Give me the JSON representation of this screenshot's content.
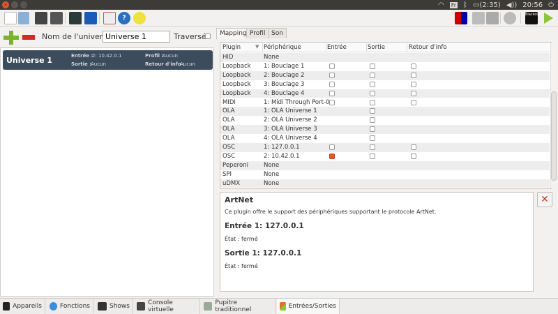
{
  "titlebar": {
    "tray": {
      "lang": "Fr",
      "battery": "(2:35)",
      "time": "20:56"
    }
  },
  "universe_editor": {
    "name_label": "Nom de l'univers :",
    "name_value": "Universe 1",
    "passthrough_label": "Traversé"
  },
  "universe_list": [
    {
      "name": "Universe 1",
      "input_label": "Entrée :",
      "input": "2: 10.42.0.1",
      "output_label": "Sortie :",
      "output": "Aucun",
      "profile_label": "Profil :",
      "profile": "Aucun",
      "feedback_label": "Retour d'info :",
      "feedback": "Aucun"
    }
  ],
  "tabs": [
    "Mapping",
    "Profil",
    "Son"
  ],
  "table": {
    "headers": [
      "Plugin",
      "Périphérique",
      "Entrée",
      "Sortie",
      "Retour d'info"
    ],
    "rows": [
      {
        "plugin": "HID",
        "device": "None",
        "in": null,
        "out": null,
        "fb": null
      },
      {
        "plugin": "Loopback",
        "device": "1: Bouclage 1",
        "in": false,
        "out": false,
        "fb": false
      },
      {
        "plugin": "Loopback",
        "device": "2: Bouclage 2",
        "in": false,
        "out": false,
        "fb": false
      },
      {
        "plugin": "Loopback",
        "device": "3: Bouclage 3",
        "in": false,
        "out": false,
        "fb": false
      },
      {
        "plugin": "Loopback",
        "device": "4: Bouclage 4",
        "in": false,
        "out": false,
        "fb": false
      },
      {
        "plugin": "MIDI",
        "device": "1: Midi Through Port-0",
        "in": false,
        "out": false,
        "fb": false
      },
      {
        "plugin": "OLA",
        "device": "1: OLA Universe 1",
        "in": null,
        "out": false,
        "fb": null
      },
      {
        "plugin": "OLA",
        "device": "2: OLA Universe 2",
        "in": null,
        "out": false,
        "fb": null
      },
      {
        "plugin": "OLA",
        "device": "3: OLA Universe 3",
        "in": null,
        "out": false,
        "fb": null
      },
      {
        "plugin": "OLA",
        "device": "4: OLA Universe 4",
        "in": null,
        "out": false,
        "fb": null
      },
      {
        "plugin": "OSC",
        "device": "1: 127.0.0.1",
        "in": false,
        "out": false,
        "fb": false
      },
      {
        "plugin": "OSC",
        "device": "2: 10.42.0.1",
        "in": true,
        "out": false,
        "fb": false
      },
      {
        "plugin": "Peperoni",
        "device": "None",
        "in": null,
        "out": null,
        "fb": null
      },
      {
        "plugin": "SPI",
        "device": "None",
        "in": null,
        "out": null,
        "fb": null
      },
      {
        "plugin": "uDMX",
        "device": "None",
        "in": null,
        "out": null,
        "fb": null
      }
    ]
  },
  "info": {
    "title": "ArtNet",
    "description": "Ce plugin offre le support des périphériques supportant le protocole ArtNet.",
    "input_title": "Entrée 1: 127.0.0.1",
    "input_state": "État : fermé",
    "output_title": "Sortie 1: 127.0.0.1",
    "output_state": "État : fermé"
  },
  "toolbar_right": {
    "blackout": "Blackout"
  },
  "bottom_tabs": [
    "Appareils",
    "Fonctions",
    "Shows",
    "Console virtuelle",
    "Pupitre traditionnel",
    "Entrées/Sorties"
  ],
  "colors": {
    "accent": "#e05a2a",
    "selection": "#3d4c5c"
  }
}
